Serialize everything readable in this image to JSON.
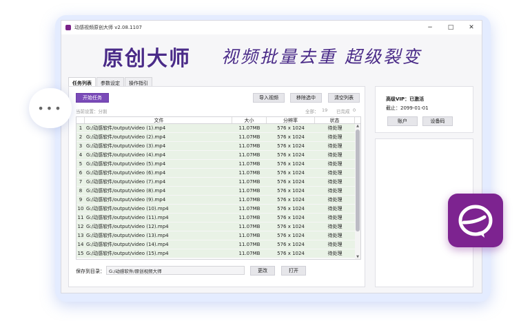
{
  "window": {
    "title": "动感视频原创大师 v2.08.1107",
    "minimize": "−",
    "maximize": "□",
    "close": "✕"
  },
  "banner": {
    "title": "原创大师",
    "slogan": "视频批量去重 超级裂变"
  },
  "tabs": [
    "任务列表",
    "参数设定",
    "操作指引"
  ],
  "toolbar": {
    "start": "开始任务",
    "import": "导入视频",
    "remove": "移除选中",
    "clear": "清空列表"
  },
  "status": {
    "mode": "当前设置：分割",
    "total": "全部：",
    "total_count": "19",
    "done": "已完成",
    "done_count": "0"
  },
  "table": {
    "headers": [
      "文件",
      "大小",
      "分辨率",
      "状态"
    ],
    "rows": [
      {
        "idx": "1",
        "file": "G:/动感软件/output/video (1).mp4",
        "size": "11.07MB",
        "res": "576 x 1024",
        "status": "待处理"
      },
      {
        "idx": "2",
        "file": "G:/动感软件/output/video (2).mp4",
        "size": "11.07MB",
        "res": "576 x 1024",
        "status": "待处理"
      },
      {
        "idx": "3",
        "file": "G:/动感软件/output/video (3).mp4",
        "size": "11.07MB",
        "res": "576 x 1024",
        "status": "待处理"
      },
      {
        "idx": "4",
        "file": "G:/动感软件/output/video (4).mp4",
        "size": "11.07MB",
        "res": "576 x 1024",
        "status": "待处理"
      },
      {
        "idx": "5",
        "file": "G:/动感软件/output/video (5).mp4",
        "size": "11.07MB",
        "res": "576 x 1024",
        "status": "待处理"
      },
      {
        "idx": "6",
        "file": "G:/动感软件/output/video (6).mp4",
        "size": "11.07MB",
        "res": "576 x 1024",
        "status": "待处理"
      },
      {
        "idx": "7",
        "file": "G:/动感软件/output/video (7).mp4",
        "size": "11.07MB",
        "res": "576 x 1024",
        "status": "待处理"
      },
      {
        "idx": "8",
        "file": "G:/动感软件/output/video (8).mp4",
        "size": "11.07MB",
        "res": "576 x 1024",
        "status": "待处理"
      },
      {
        "idx": "9",
        "file": "G:/动感软件/output/video (9).mp4",
        "size": "11.07MB",
        "res": "576 x 1024",
        "status": "待处理"
      },
      {
        "idx": "10",
        "file": "G:/动感软件/output/video (10).mp4",
        "size": "11.07MB",
        "res": "576 x 1024",
        "status": "待处理"
      },
      {
        "idx": "11",
        "file": "G:/动感软件/output/video (11).mp4",
        "size": "11.07MB",
        "res": "576 x 1024",
        "status": "待处理"
      },
      {
        "idx": "12",
        "file": "G:/动感软件/output/video (12).mp4",
        "size": "11.07MB",
        "res": "576 x 1024",
        "status": "待处理"
      },
      {
        "idx": "13",
        "file": "G:/动感软件/output/video (13).mp4",
        "size": "11.07MB",
        "res": "576 x 1024",
        "status": "待处理"
      },
      {
        "idx": "14",
        "file": "G:/动感软件/output/video (14).mp4",
        "size": "11.07MB",
        "res": "576 x 1024",
        "status": "待处理"
      },
      {
        "idx": "15",
        "file": "G:/动感软件/output/video (15).mp4",
        "size": "11.07MB",
        "res": "576 x 1024",
        "status": "待处理"
      }
    ]
  },
  "save": {
    "label": "保存到目录：",
    "path": "G:/动感软件/原创视频大师",
    "change": "更改",
    "open": "打开"
  },
  "account": {
    "vip": "高级VIP：已激活",
    "expiry": "截止：2099-01-01",
    "account_btn": "账户",
    "device_btn": "设备码"
  },
  "colors": {
    "accent": "#7a4bb8",
    "brand": "#7d2390",
    "row_bg": "#e9f2e6"
  }
}
